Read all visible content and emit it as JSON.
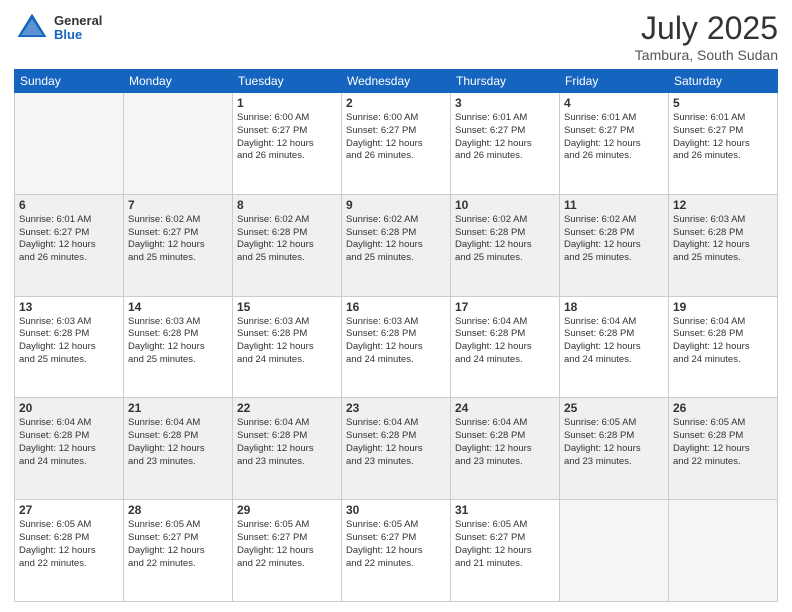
{
  "header": {
    "logo": {
      "general": "General",
      "blue": "Blue"
    },
    "title": "July 2025",
    "location": "Tambura, South Sudan"
  },
  "weekdays": [
    "Sunday",
    "Monday",
    "Tuesday",
    "Wednesday",
    "Thursday",
    "Friday",
    "Saturday"
  ],
  "weeks": [
    [
      {
        "day": "",
        "info": ""
      },
      {
        "day": "",
        "info": ""
      },
      {
        "day": "1",
        "info": "Sunrise: 6:00 AM\nSunset: 6:27 PM\nDaylight: 12 hours\nand 26 minutes."
      },
      {
        "day": "2",
        "info": "Sunrise: 6:00 AM\nSunset: 6:27 PM\nDaylight: 12 hours\nand 26 minutes."
      },
      {
        "day": "3",
        "info": "Sunrise: 6:01 AM\nSunset: 6:27 PM\nDaylight: 12 hours\nand 26 minutes."
      },
      {
        "day": "4",
        "info": "Sunrise: 6:01 AM\nSunset: 6:27 PM\nDaylight: 12 hours\nand 26 minutes."
      },
      {
        "day": "5",
        "info": "Sunrise: 6:01 AM\nSunset: 6:27 PM\nDaylight: 12 hours\nand 26 minutes."
      }
    ],
    [
      {
        "day": "6",
        "info": "Sunrise: 6:01 AM\nSunset: 6:27 PM\nDaylight: 12 hours\nand 26 minutes."
      },
      {
        "day": "7",
        "info": "Sunrise: 6:02 AM\nSunset: 6:27 PM\nDaylight: 12 hours\nand 25 minutes."
      },
      {
        "day": "8",
        "info": "Sunrise: 6:02 AM\nSunset: 6:28 PM\nDaylight: 12 hours\nand 25 minutes."
      },
      {
        "day": "9",
        "info": "Sunrise: 6:02 AM\nSunset: 6:28 PM\nDaylight: 12 hours\nand 25 minutes."
      },
      {
        "day": "10",
        "info": "Sunrise: 6:02 AM\nSunset: 6:28 PM\nDaylight: 12 hours\nand 25 minutes."
      },
      {
        "day": "11",
        "info": "Sunrise: 6:02 AM\nSunset: 6:28 PM\nDaylight: 12 hours\nand 25 minutes."
      },
      {
        "day": "12",
        "info": "Sunrise: 6:03 AM\nSunset: 6:28 PM\nDaylight: 12 hours\nand 25 minutes."
      }
    ],
    [
      {
        "day": "13",
        "info": "Sunrise: 6:03 AM\nSunset: 6:28 PM\nDaylight: 12 hours\nand 25 minutes."
      },
      {
        "day": "14",
        "info": "Sunrise: 6:03 AM\nSunset: 6:28 PM\nDaylight: 12 hours\nand 25 minutes."
      },
      {
        "day": "15",
        "info": "Sunrise: 6:03 AM\nSunset: 6:28 PM\nDaylight: 12 hours\nand 24 minutes."
      },
      {
        "day": "16",
        "info": "Sunrise: 6:03 AM\nSunset: 6:28 PM\nDaylight: 12 hours\nand 24 minutes."
      },
      {
        "day": "17",
        "info": "Sunrise: 6:04 AM\nSunset: 6:28 PM\nDaylight: 12 hours\nand 24 minutes."
      },
      {
        "day": "18",
        "info": "Sunrise: 6:04 AM\nSunset: 6:28 PM\nDaylight: 12 hours\nand 24 minutes."
      },
      {
        "day": "19",
        "info": "Sunrise: 6:04 AM\nSunset: 6:28 PM\nDaylight: 12 hours\nand 24 minutes."
      }
    ],
    [
      {
        "day": "20",
        "info": "Sunrise: 6:04 AM\nSunset: 6:28 PM\nDaylight: 12 hours\nand 24 minutes."
      },
      {
        "day": "21",
        "info": "Sunrise: 6:04 AM\nSunset: 6:28 PM\nDaylight: 12 hours\nand 23 minutes."
      },
      {
        "day": "22",
        "info": "Sunrise: 6:04 AM\nSunset: 6:28 PM\nDaylight: 12 hours\nand 23 minutes."
      },
      {
        "day": "23",
        "info": "Sunrise: 6:04 AM\nSunset: 6:28 PM\nDaylight: 12 hours\nand 23 minutes."
      },
      {
        "day": "24",
        "info": "Sunrise: 6:04 AM\nSunset: 6:28 PM\nDaylight: 12 hours\nand 23 minutes."
      },
      {
        "day": "25",
        "info": "Sunrise: 6:05 AM\nSunset: 6:28 PM\nDaylight: 12 hours\nand 23 minutes."
      },
      {
        "day": "26",
        "info": "Sunrise: 6:05 AM\nSunset: 6:28 PM\nDaylight: 12 hours\nand 22 minutes."
      }
    ],
    [
      {
        "day": "27",
        "info": "Sunrise: 6:05 AM\nSunset: 6:28 PM\nDaylight: 12 hours\nand 22 minutes."
      },
      {
        "day": "28",
        "info": "Sunrise: 6:05 AM\nSunset: 6:27 PM\nDaylight: 12 hours\nand 22 minutes."
      },
      {
        "day": "29",
        "info": "Sunrise: 6:05 AM\nSunset: 6:27 PM\nDaylight: 12 hours\nand 22 minutes."
      },
      {
        "day": "30",
        "info": "Sunrise: 6:05 AM\nSunset: 6:27 PM\nDaylight: 12 hours\nand 22 minutes."
      },
      {
        "day": "31",
        "info": "Sunrise: 6:05 AM\nSunset: 6:27 PM\nDaylight: 12 hours\nand 21 minutes."
      },
      {
        "day": "",
        "info": ""
      },
      {
        "day": "",
        "info": ""
      }
    ]
  ]
}
